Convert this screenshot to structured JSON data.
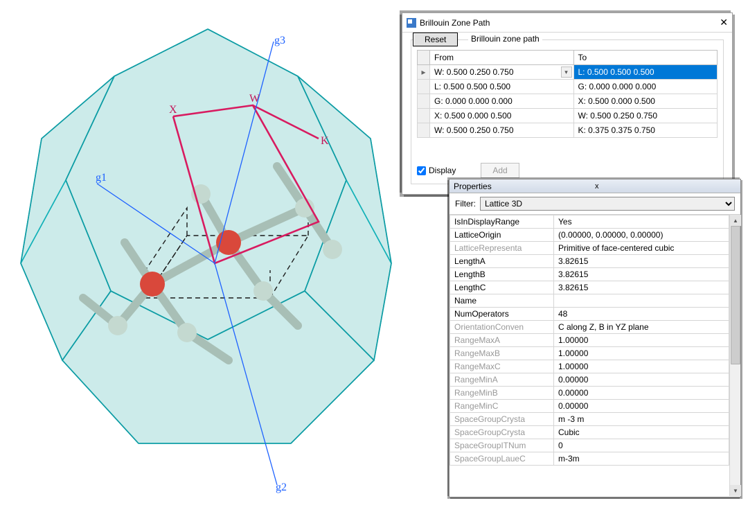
{
  "viewport": {
    "axis_g1": "g1",
    "axis_g2": "g2",
    "axis_g3": "g3",
    "label_X": "X",
    "label_W": "W",
    "label_K": "K"
  },
  "bz_window": {
    "title": "Brillouin Zone Path",
    "close": "✕",
    "reset": "Reset",
    "group_label": "Brillouin zone path",
    "col_from": "From",
    "col_to": "To",
    "rows": [
      {
        "from": "W:  0.500  0.250  0.750",
        "to": "L:  0.500  0.500  0.500",
        "marker": "▸",
        "sel": true
      },
      {
        "from": "L:  0.500  0.500  0.500",
        "to": "G:  0.000  0.000  0.000"
      },
      {
        "from": "G:  0.000  0.000  0.000",
        "to": "X:  0.500  0.000  0.500"
      },
      {
        "from": "X:  0.500  0.000  0.500",
        "to": "W:  0.500  0.250  0.750"
      },
      {
        "from": "W:  0.500  0.250  0.750",
        "to": "K:  0.375  0.375  0.750"
      }
    ],
    "display_chk": "Display",
    "add": "Add"
  },
  "properties": {
    "title": "Properties",
    "close": "x",
    "filter_label": "Filter:",
    "filter_value": "Lattice 3D",
    "rows": [
      {
        "k": "IsInDisplayRange",
        "v": "Yes"
      },
      {
        "k": "LatticeOrigin",
        "v": "(0.00000, 0.00000, 0.00000)"
      },
      {
        "k": "LatticeRepresenta",
        "v": "Primitive of face-centered cubic",
        "gray": true
      },
      {
        "k": "LengthA",
        "v": "3.82615"
      },
      {
        "k": "LengthB",
        "v": "3.82615"
      },
      {
        "k": "LengthC",
        "v": "3.82615"
      },
      {
        "k": "Name",
        "v": ""
      },
      {
        "k": "NumOperators",
        "v": "48"
      },
      {
        "k": "OrientationConven",
        "v": "C along Z, B in YZ plane",
        "gray": true
      },
      {
        "k": "RangeMaxA",
        "v": "1.00000",
        "gray": true
      },
      {
        "k": "RangeMaxB",
        "v": "1.00000",
        "gray": true
      },
      {
        "k": "RangeMaxC",
        "v": "1.00000",
        "gray": true
      },
      {
        "k": "RangeMinA",
        "v": "0.00000",
        "gray": true
      },
      {
        "k": "RangeMinB",
        "v": "0.00000",
        "gray": true
      },
      {
        "k": "RangeMinC",
        "v": "0.00000",
        "gray": true
      },
      {
        "k": "SpaceGroupCrysta",
        "v": "m -3 m",
        "gray": true
      },
      {
        "k": "SpaceGroupCrysta",
        "v": "Cubic",
        "gray": true
      },
      {
        "k": "SpaceGroupITNum",
        "v": "0",
        "gray": true
      },
      {
        "k": "SpaceGroupLaueC",
        "v": "m-3m",
        "gray": true
      }
    ]
  }
}
